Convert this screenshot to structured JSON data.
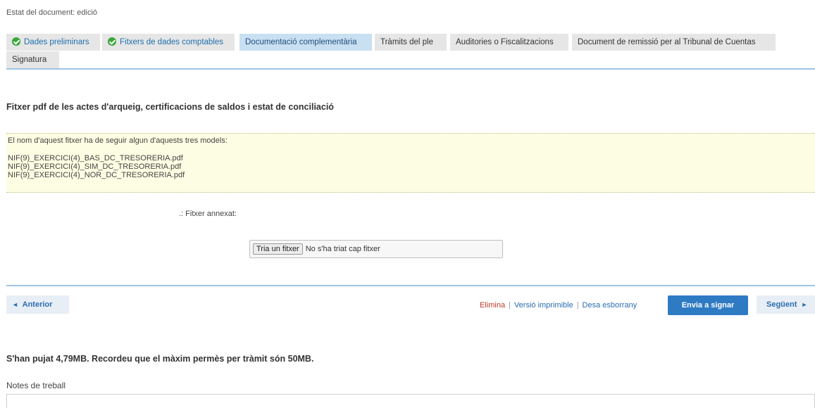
{
  "status": "Estat del document: edició",
  "tabs": [
    {
      "label": "Dades preliminars",
      "state": "done"
    },
    {
      "label": "Fitxers de dades comptables",
      "state": "done"
    },
    {
      "label": "Documentació complementària",
      "state": "active"
    },
    {
      "label": "Tràmits del ple",
      "state": "normal"
    },
    {
      "label": "Auditories o Fiscalitzacions",
      "state": "normal"
    },
    {
      "label": "Document de remissió per al Tribunal de Cuentas",
      "state": "normal"
    },
    {
      "label": "Signatura",
      "state": "normal"
    }
  ],
  "section": {
    "title": "Fitxer pdf de les actes d'arqueig, certificacions de saldos i estat de conciliació",
    "info": {
      "intro": "El nom d'aquest fitxer ha de seguir algun d'aquests tres models:",
      "models": [
        "NIF(9)_EXERCICI(4)_BAS_DC_TRESORERIA.pdf",
        "NIF(9)_EXERCICI(4)_SIM_DC_TRESORERIA.pdf",
        "NIF(9)_EXERCICI(4)_NOR_DC_TRESORERIA.pdf"
      ]
    },
    "attach_label": ".: Fitxer annexat:",
    "file_button": "Tria un fitxer",
    "file_status": "No s'ha triat cap fitxer"
  },
  "nav": {
    "prev_arrow": "◄",
    "prev": "Anterior",
    "delete": "Elimina",
    "sep": "|",
    "print": "Versió imprimible",
    "draft": "Desa esborrany",
    "sign": "Envia a signar",
    "next": "Següent",
    "next_arrow": "►"
  },
  "upload_note": "S'han pujat 4,79MB. Recordeu que el màxim permès per tràmit són 50MB.",
  "notes_label": "Notes de treball",
  "colors": {
    "accent": "#2e7bc4",
    "active_tab": "#c9dff2",
    "done_check": "#3aa63a",
    "delete_link": "#c0392b",
    "info_bg": "#fdfde3"
  }
}
